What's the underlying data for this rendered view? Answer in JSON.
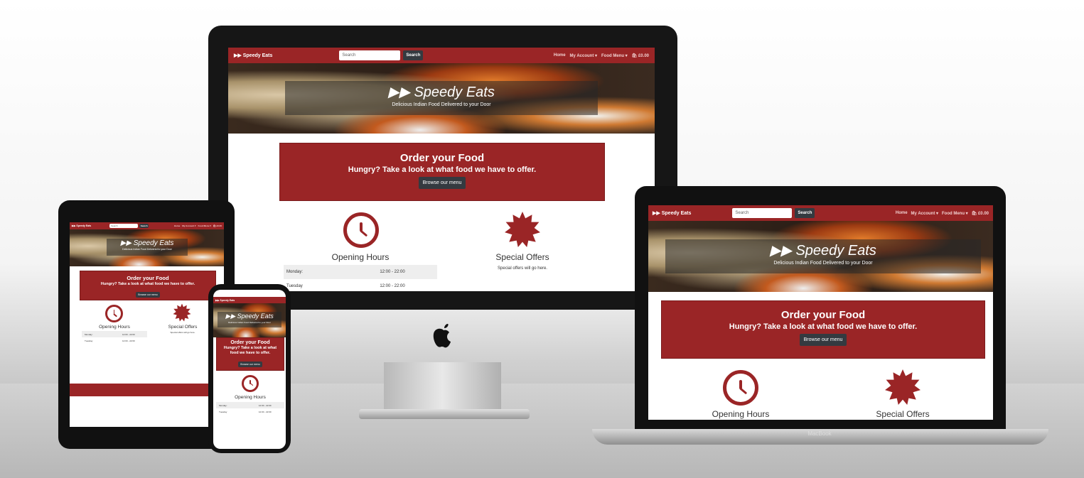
{
  "site": {
    "brand": "Speedy Eats",
    "search_placeholder": "Search",
    "search_button": "Search",
    "nav_links": [
      "Home",
      "My Account ▾",
      "Food Menu ▾",
      "🛍 £0.00"
    ],
    "hero_title": "Speedy Eats",
    "hero_subtitle": "Delicious Indian Food Delivered to your Door",
    "order_heading": "Order your Food",
    "order_subheading": "Hungry? Take a look at what food we have to offer.",
    "order_button": "Browse our menu",
    "opening_hours_heading": "Opening Hours",
    "special_offers_heading": "Special Offers",
    "special_offers_text": "Special offers will go here.",
    "hours": [
      {
        "day": "Monday:",
        "time": "12:00 - 22:00"
      },
      {
        "day": "Tuesday",
        "time": "12:00 - 22:00"
      }
    ]
  },
  "laptop_label": "MacBook",
  "icons": {
    "brand": "fast-forward-icon",
    "clock": "clock-icon",
    "offers": "starburst-icon",
    "cart": "shopping-bag-icon",
    "apple_logo": "apple-logo-icon"
  },
  "colors": {
    "brand_red": "#9a2526",
    "dark_button": "#343a40"
  }
}
